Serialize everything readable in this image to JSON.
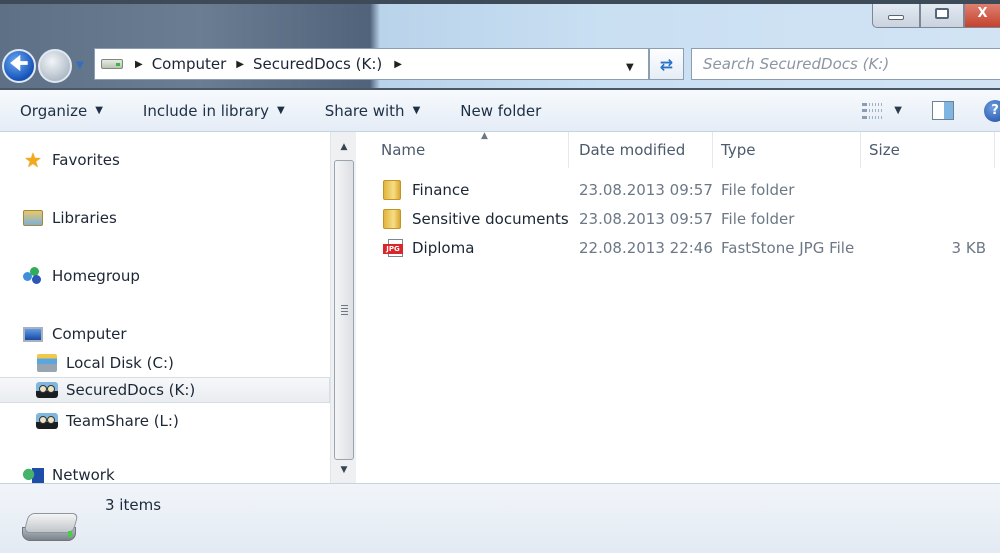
{
  "window": {
    "controls": {
      "minimize": "minimize",
      "maximize": "maximize",
      "close": "X"
    }
  },
  "nav": {
    "back_icon": "back-arrow-icon",
    "forward_icon": "forward-arrow-icon",
    "recent_icon": "chevron-down-icon"
  },
  "address": {
    "icon": "drive-icon",
    "breadcrumbs": [
      "Computer",
      "SecuredDocs (K:)"
    ],
    "refresh_icon": "refresh-icon"
  },
  "search": {
    "placeholder": "Search SecuredDocs (K:)"
  },
  "toolbar": {
    "organize": "Organize",
    "include_in_library": "Include in library",
    "share_with": "Share with",
    "new_folder": "New folder",
    "help_glyph": "?"
  },
  "sidebar": {
    "items": [
      {
        "label": "Favorites",
        "icon": "star-icon"
      },
      {
        "label": "Libraries",
        "icon": "libraries-icon"
      },
      {
        "label": "Homegroup",
        "icon": "homegroup-icon"
      },
      {
        "label": "Computer",
        "icon": "computer-icon"
      },
      {
        "label": "Local Disk (C:)",
        "icon": "local-disk-icon"
      },
      {
        "label": "SecuredDocs (K:)",
        "icon": "network-drive-icon",
        "selected": true
      },
      {
        "label": "TeamShare (L:)",
        "icon": "network-drive-icon"
      },
      {
        "label": "Network",
        "icon": "network-icon"
      }
    ]
  },
  "files": {
    "columns": {
      "name": "Name",
      "date": "Date modified",
      "type": "Type",
      "size": "Size"
    },
    "sorted_by": "Name",
    "rows": [
      {
        "name": "Finance",
        "date": "23.08.2013 09:57",
        "type": "File folder",
        "size": "",
        "icon": "folder-icon"
      },
      {
        "name": "Sensitive documents",
        "date": "23.08.2013 09:57",
        "type": "File folder",
        "size": "",
        "icon": "folder-icon"
      },
      {
        "name": "Diploma",
        "date": "22.08.2013 22:46",
        "type": "FastStone JPG File",
        "size": "3 KB",
        "icon": "jpg-file-icon",
        "icon_label": "JPG"
      }
    ]
  },
  "status": {
    "count": "3 items",
    "icon": "drive-icon"
  }
}
